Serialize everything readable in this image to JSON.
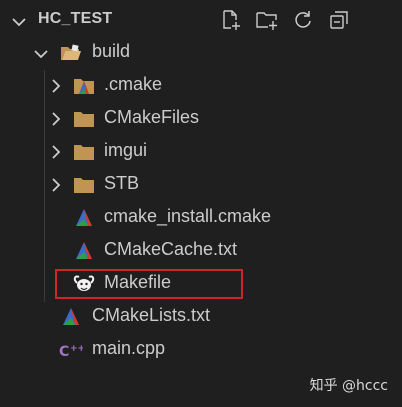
{
  "explorer": {
    "title": "HC_TEST",
    "actions": [
      {
        "name": "new-file-icon"
      },
      {
        "name": "new-folder-icon"
      },
      {
        "name": "refresh-icon"
      },
      {
        "name": "collapse-all-icon"
      }
    ]
  },
  "tree": {
    "items": [
      {
        "label": "build",
        "icon": "folder-open-icon",
        "expanded": true
      },
      {
        "label": ".cmake",
        "icon": "cmake-folder-icon",
        "expanded": false
      },
      {
        "label": "CMakeFiles",
        "icon": "folder-icon",
        "expanded": false
      },
      {
        "label": "imgui",
        "icon": "folder-icon",
        "expanded": false
      },
      {
        "label": "STB",
        "icon": "folder-icon",
        "expanded": false
      },
      {
        "label": "cmake_install.cmake",
        "icon": "cmake-icon"
      },
      {
        "label": "CMakeCache.txt",
        "icon": "cmake-icon"
      },
      {
        "label": "Makefile",
        "icon": "gnu-makefile-icon",
        "highlighted": true
      },
      {
        "label": "CMakeLists.txt",
        "icon": "cmake-icon"
      },
      {
        "label": "main.cpp",
        "icon": "cpp-icon"
      }
    ]
  },
  "watermark": "知乎 @hccc",
  "colors": {
    "background": "#1f1f1f",
    "folder": "#c09553",
    "highlight_border": "#d02525",
    "cpp": "#a074c4"
  }
}
